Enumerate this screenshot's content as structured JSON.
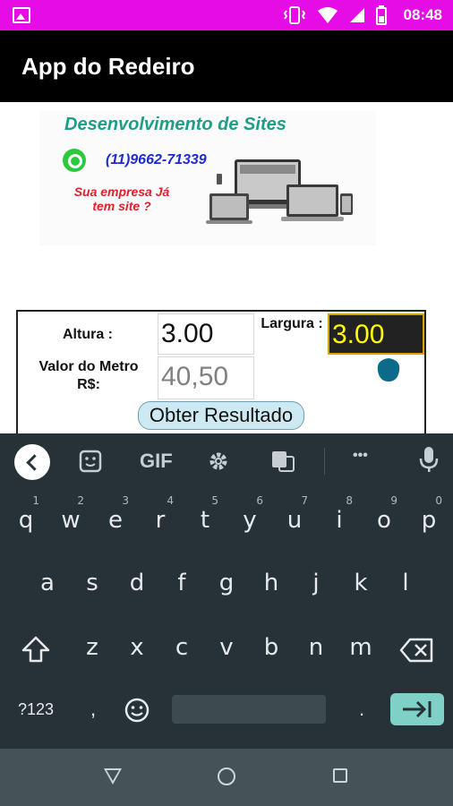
{
  "status_bar": {
    "time": "08:48",
    "background": "#e60ce6"
  },
  "app_bar": {
    "title": "App do Redeiro"
  },
  "banner": {
    "title": "Desenvolvimento de Sites",
    "phone": "(11)9662-71339",
    "question": "Sua empresa Já tem site ?"
  },
  "form": {
    "altura_label": "Altura :",
    "altura_value": "3.00",
    "largura_label": "Largura :",
    "largura_value": "3.00",
    "valor_label": "Valor do Metro R$:",
    "valor_value": "40,50",
    "button_label": "Obter Resultado"
  },
  "keyboard": {
    "toolbar": {
      "gif": "GIF",
      "more": "•••"
    },
    "row1": [
      {
        "k": "q",
        "s": "1"
      },
      {
        "k": "w",
        "s": "2"
      },
      {
        "k": "e",
        "s": "3"
      },
      {
        "k": "r",
        "s": "4"
      },
      {
        "k": "t",
        "s": "5"
      },
      {
        "k": "y",
        "s": "6"
      },
      {
        "k": "u",
        "s": "7"
      },
      {
        "k": "i",
        "s": "8"
      },
      {
        "k": "o",
        "s": "9"
      },
      {
        "k": "p",
        "s": "0"
      }
    ],
    "row2": [
      "a",
      "s",
      "d",
      "f",
      "g",
      "h",
      "j",
      "k",
      "l"
    ],
    "row3": [
      "z",
      "x",
      "c",
      "v",
      "b",
      "n",
      "m"
    ],
    "symbols_label": "?123",
    "comma_label": ",",
    "period_label": "."
  }
}
